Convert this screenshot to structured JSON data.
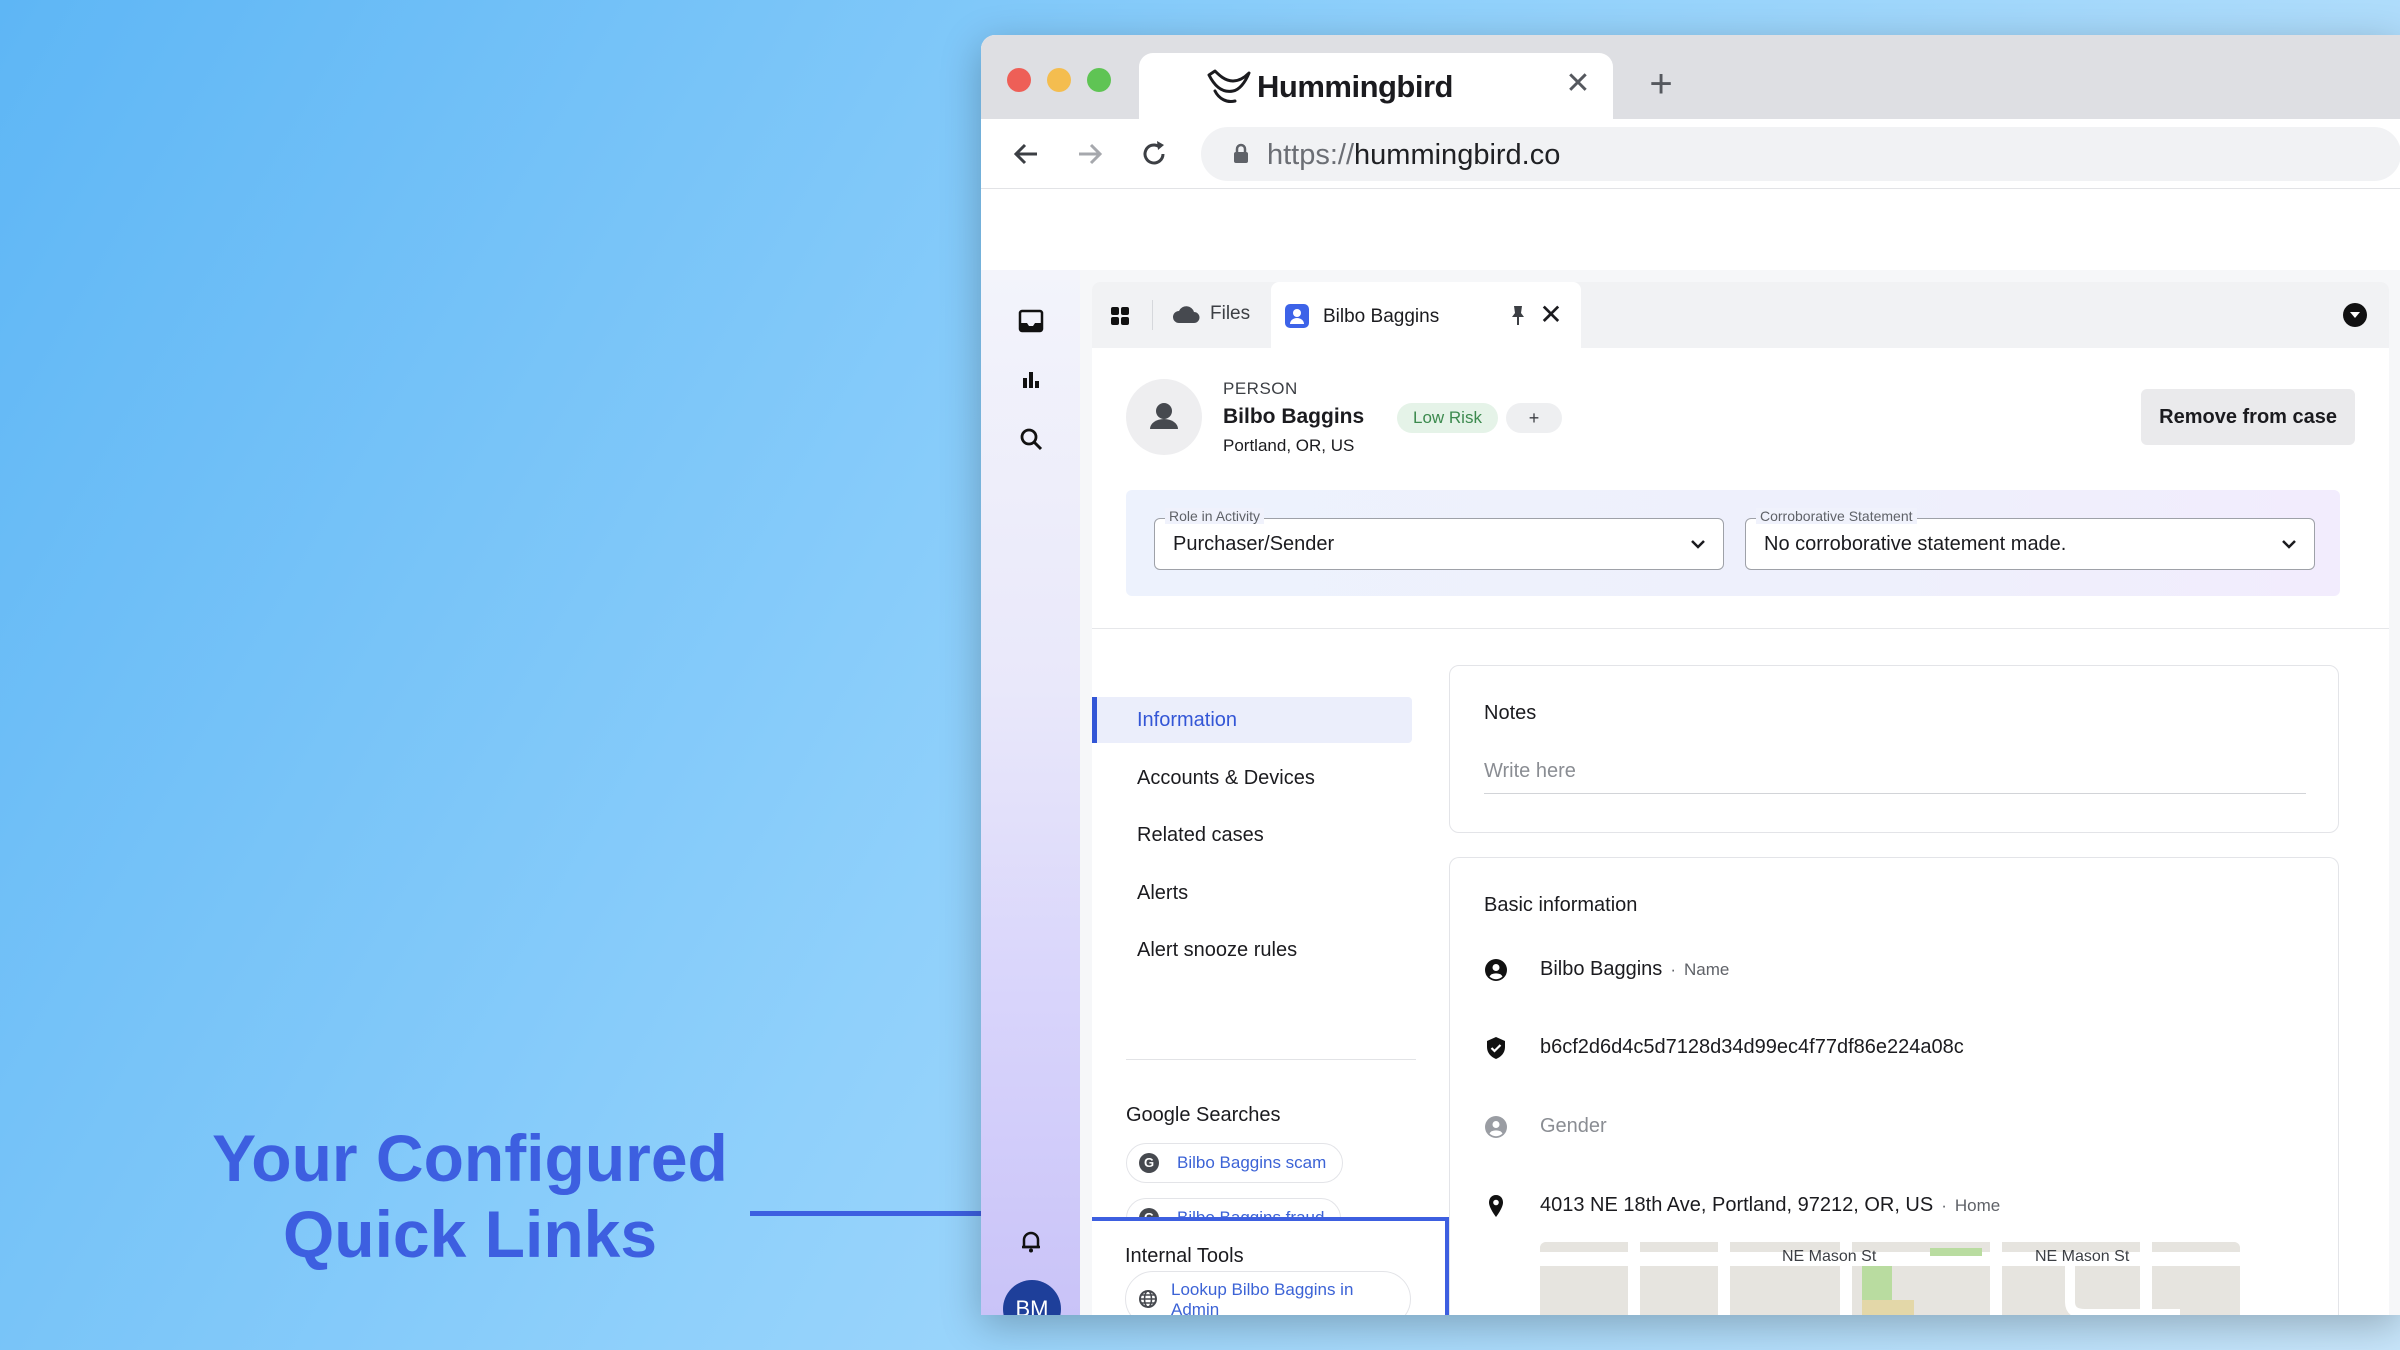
{
  "callout": {
    "line1": "Your Configured",
    "line2": "Quick Links"
  },
  "browser": {
    "tab_title": "Hummingbird",
    "url_scheme": "https://",
    "url_host": "hummingbird.co"
  },
  "app": {
    "tabs": [
      {
        "label": "Files"
      },
      {
        "label": "Bilbo Baggins"
      }
    ],
    "avatar_initials": "BM",
    "person": {
      "kind": "PERSON",
      "name": "Bilbo Baggins",
      "location": "Portland, OR, US",
      "risk_badge": "Low Risk",
      "add_badge": "+",
      "remove_button": "Remove from case"
    },
    "role": {
      "label": "Role in Activity",
      "value": "Purchaser/Sender"
    },
    "corroborative": {
      "label": "Corroborative Statement",
      "value": "No corroborative statement made."
    },
    "subnav": [
      {
        "label": "Information",
        "active": true
      },
      {
        "label": "Accounts & Devices"
      },
      {
        "label": "Related cases"
      },
      {
        "label": "Alerts"
      },
      {
        "label": "Alert snooze rules"
      }
    ],
    "google_searches": {
      "title": "Google Searches",
      "links": [
        "Bilbo Baggins scam",
        "Bilbo Baggins fraud"
      ]
    },
    "internal_tools": {
      "title": "Internal Tools",
      "link": "Lookup Bilbo Baggins in Admin"
    },
    "notes": {
      "title": "Notes",
      "placeholder": "Write here"
    },
    "basic_info": {
      "title": "Basic information",
      "name": "Bilbo Baggins",
      "name_sub": "Name",
      "hash": "b6cf2d6d4c5d7128d34d99ec4f77df86e224a08c",
      "gender": "Gender",
      "address": "4013 NE 18th Ave, Portland, 97212, OR, US",
      "address_sub": "Home",
      "map_streets": [
        "NE Mason St",
        "NE Mason St"
      ]
    }
  }
}
